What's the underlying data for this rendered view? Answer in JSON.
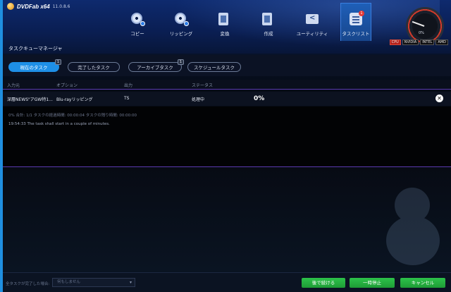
{
  "app": {
    "name": "DVDFab x64",
    "version": "11.0.8.6",
    "page_title": "タスクキューマネージャ"
  },
  "nav": [
    {
      "label": "コピー",
      "icon": "copy-disc-icon"
    },
    {
      "label": "リッピング",
      "icon": "ripper-disc-icon"
    },
    {
      "label": "変換",
      "icon": "converter-film-icon"
    },
    {
      "label": "作成",
      "icon": "creator-film-icon"
    },
    {
      "label": "ユーティリティ",
      "icon": "utility-folder-icon"
    },
    {
      "label": "タスクリスト",
      "icon": "task-list-icon",
      "badge": "1",
      "active": true
    }
  ],
  "gauge": {
    "readout": "0%",
    "cpu": "CPU",
    "gpu1": "NVIDIA",
    "gpu2": "INTEL",
    "gpu3": "AMD"
  },
  "subtabs": [
    {
      "label": "現在のタスク",
      "count": "1",
      "active": true
    },
    {
      "label": "完了したタスク",
      "count": ""
    },
    {
      "label": "アーカイブタスク",
      "count": "1"
    },
    {
      "label": "スケジュールタスク",
      "count": ""
    }
  ],
  "table": {
    "headers": {
      "input": "入力元",
      "option": "オプション",
      "output": "出力",
      "status": "ステータス"
    },
    "row": {
      "input": "深層NEWS\"アGW特1...",
      "option": "Blu-rayリッピング",
      "output": "TS",
      "status": "処理中",
      "progress": "0%"
    }
  },
  "log": {
    "line1": "0%   合計: 1/1  タスクの経過時間: 00:00:04  タスクの残り時間: 00:00:00",
    "line2": "19:54:33    The task shall start in a couple of minutes."
  },
  "footer": {
    "label": "全タスクが完了した場合:",
    "select_value": "何もしません",
    "continue_label": "後で続ける",
    "pause_label": "一時停止",
    "cancel_label": "キャンセル"
  },
  "colors": {
    "accent": "#1e8fe6",
    "button": "#2dc24a",
    "divider": "#5a3ab0"
  }
}
